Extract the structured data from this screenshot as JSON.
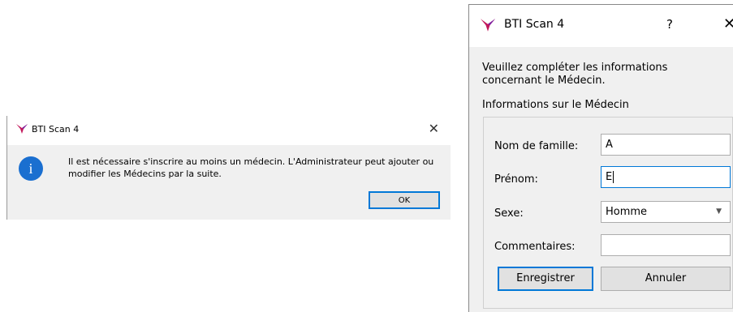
{
  "message_box": {
    "title": "BTI Scan 4",
    "close_label": "✕",
    "message": "Il est nécessaire s'inscrire au moins un médecin. L'Administrateur peut ajouter ou modifier les Médecins par la suite.",
    "ok_label": "OK",
    "icon": "info-icon",
    "icon_glyph": "i"
  },
  "form_dialog": {
    "title": "BTI Scan 4",
    "help_label": "?",
    "close_label": "✕",
    "instructions": "Veuillez compléter les  informations concernant le Médecin.",
    "section_label": "Informations sur le Médecin",
    "fields": {
      "last_name_label": "Nom de famille:",
      "last_name_value": "A",
      "first_name_label": "Prénom:",
      "first_name_value": "E",
      "sex_label": "Sexe:",
      "sex_value": "Homme",
      "comments_label": "Commentaires:",
      "comments_value": ""
    },
    "save_label": "Enregistrer",
    "cancel_label": "Annuler"
  },
  "colors": {
    "logo_primary": "#c2185b",
    "logo_secondary": "#7b1fa2",
    "accent": "#0078d7",
    "info_blue": "#1a6fd0"
  }
}
